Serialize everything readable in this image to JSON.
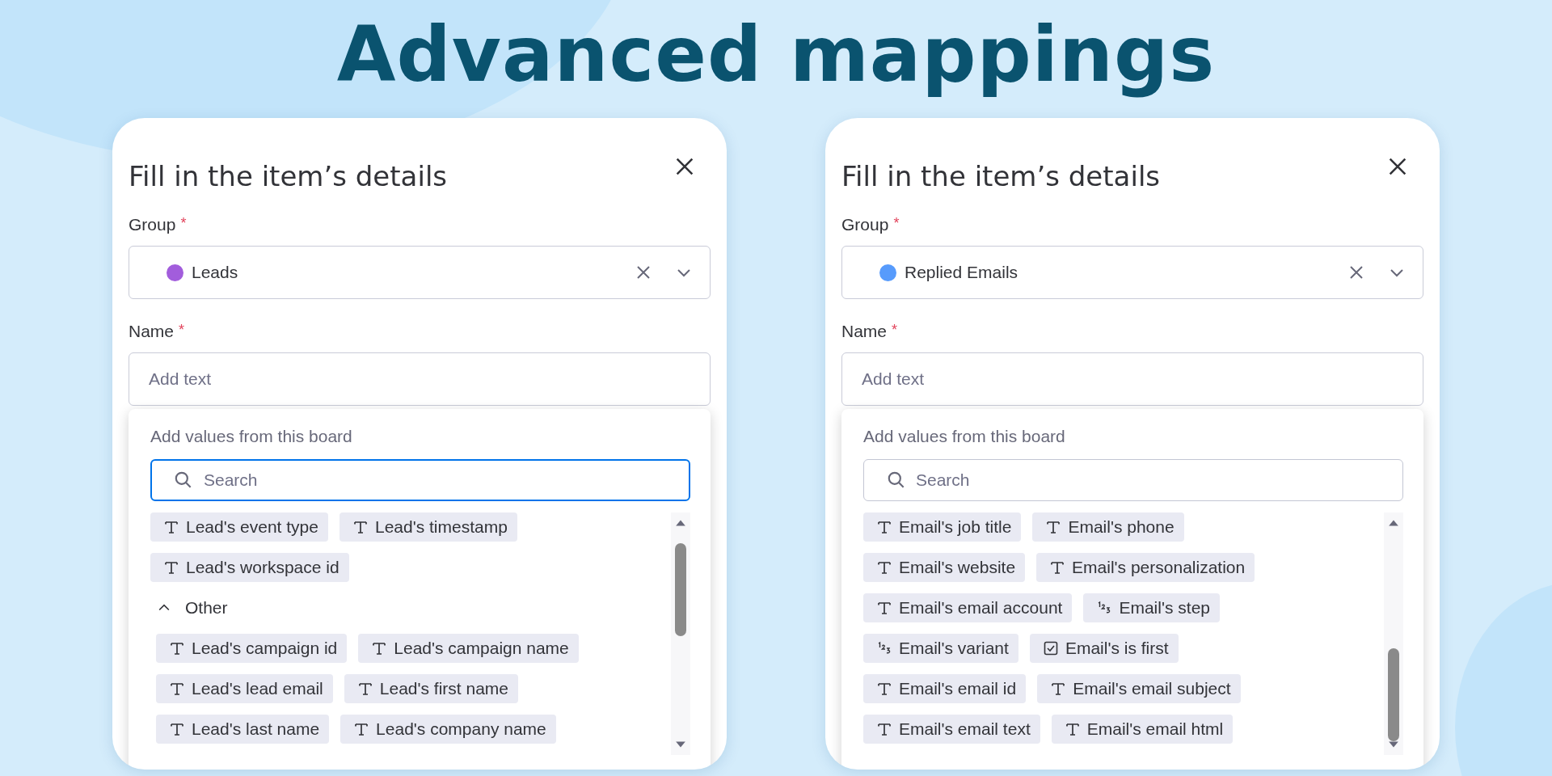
{
  "headline": "Advanced mappings",
  "cards": [
    {
      "title": "Fill in the item’s details",
      "group_field": {
        "label": "Group",
        "required_mark": "*",
        "value": "Leads",
        "color": "#a25ddc"
      },
      "name_field": {
        "label": "Name",
        "required_mark": "*",
        "placeholder": "Add text"
      },
      "dropdown": {
        "heading": "Add values from this board",
        "search": {
          "placeholder": "Search",
          "focused": true
        },
        "sections": [
          {
            "rows": [
              [
                {
                  "kind": "text",
                  "label": "Lead's event type"
                },
                {
                  "kind": "text",
                  "label": "Lead's timestamp"
                }
              ],
              [
                {
                  "kind": "text",
                  "label": "Lead's workspace id"
                }
              ]
            ]
          },
          {
            "title": "Other",
            "expanded": true,
            "rows": [
              [
                {
                  "kind": "text",
                  "label": "Lead's campaign id"
                },
                {
                  "kind": "text",
                  "label": "Lead's campaign name"
                }
              ],
              [
                {
                  "kind": "text",
                  "label": "Lead's lead email"
                },
                {
                  "kind": "text",
                  "label": "Lead's first name"
                }
              ],
              [
                {
                  "kind": "text",
                  "label": "Lead's last name"
                },
                {
                  "kind": "text",
                  "label": "Lead's company name"
                }
              ]
            ]
          }
        ]
      }
    },
    {
      "title": "Fill in the item’s details",
      "group_field": {
        "label": "Group",
        "required_mark": "*",
        "value": "Replied Emails",
        "color": "#579bfc"
      },
      "name_field": {
        "label": "Name",
        "required_mark": "*",
        "placeholder": "Add text"
      },
      "dropdown": {
        "heading": "Add values from this board",
        "search": {
          "placeholder": "Search",
          "focused": false
        },
        "sections": [
          {
            "rows": [
              [
                {
                  "kind": "text",
                  "label": "Email's job title"
                },
                {
                  "kind": "text",
                  "label": "Email's phone"
                }
              ],
              [
                {
                  "kind": "text",
                  "label": "Email's website"
                },
                {
                  "kind": "text",
                  "label": "Email's personalization"
                }
              ],
              [
                {
                  "kind": "text",
                  "label": "Email's email account"
                },
                {
                  "kind": "number",
                  "label": "Email's step"
                }
              ],
              [
                {
                  "kind": "number",
                  "label": "Email's variant"
                },
                {
                  "kind": "checkbox",
                  "label": "Email's is first"
                }
              ],
              [
                {
                  "kind": "text",
                  "label": "Email's email id"
                },
                {
                  "kind": "text",
                  "label": "Email's email subject"
                }
              ],
              [
                {
                  "kind": "text",
                  "label": "Email's email text"
                },
                {
                  "kind": "text",
                  "label": "Email's email html"
                }
              ]
            ]
          }
        ]
      }
    }
  ]
}
